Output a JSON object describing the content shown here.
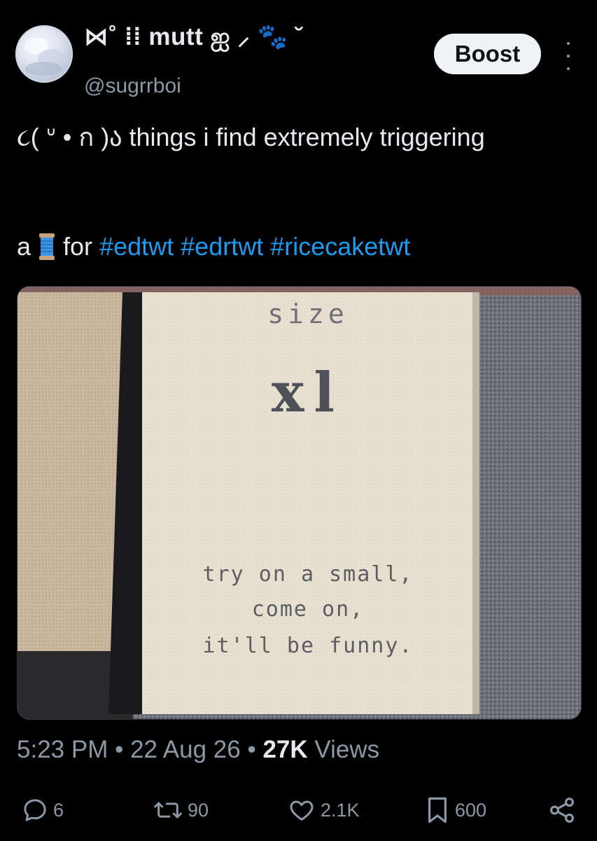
{
  "author": {
    "display_name": "⋈˚ ⁞⁞ mutt ஐ ⸝ 🐾 ˘",
    "handle": "@sugrrboi"
  },
  "boost_label": "Boost",
  "post": {
    "text_line1": "૮( ᐡ • ก )ა things i find extremely triggering",
    "prefix": "a",
    "thread_emoji": "spool-icon",
    "for_word": "for",
    "hashtags": [
      "#edtwt",
      "#edrtwt",
      "#ricecaketwt"
    ]
  },
  "media": {
    "label_text": {
      "size_heading": "size",
      "size_value": "xl",
      "line1": "try on a small,",
      "line2": "come on,",
      "line3": "it'll be funny."
    }
  },
  "meta": {
    "time": "5:23 PM",
    "date": "22 Aug 26",
    "views_count": "27K",
    "views_label": "Views"
  },
  "actions": {
    "replies": "6",
    "reposts": "90",
    "likes": "2.1K",
    "bookmarks": "600"
  },
  "colors": {
    "background": "#000000",
    "text": "#e7e9ea",
    "muted": "#8b98a5",
    "link": "#1d9bf0"
  }
}
